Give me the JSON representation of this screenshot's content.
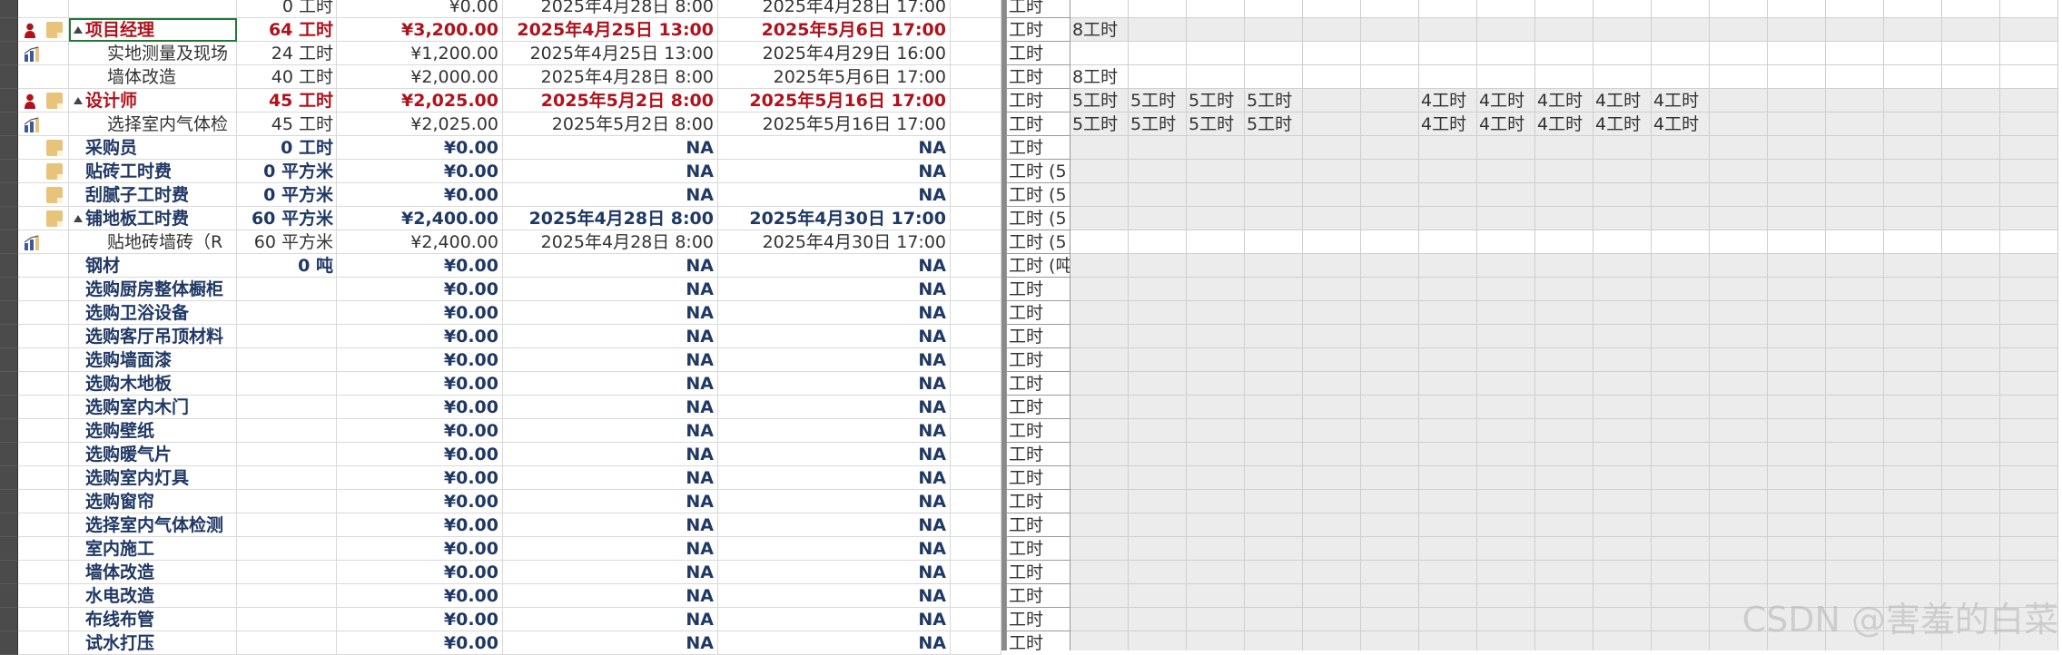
{
  "colors": {
    "summary_red": "#b0121b",
    "summary_blue": "#1f3864",
    "note_icon": "#e8c37a"
  },
  "tasks": [
    {
      "num": "",
      "icons": [],
      "name": "",
      "work": "0 工时",
      "cost": "¥0.00",
      "start": "2025年4月28日 8:00",
      "finish": "2025年4月28日 17:00",
      "style": "normal",
      "indent": 2,
      "tl_label": "工时",
      "tl": []
    },
    {
      "num": "",
      "icons": [
        "person-icon",
        "note-icon"
      ],
      "name": "项目经理",
      "work": "64 工时",
      "cost": "¥3,200.00",
      "start": "2025年4月25日 13:00",
      "finish": "2025年5月6日 17:00",
      "style": "summary-red",
      "indent": 0,
      "collapsible": true,
      "selected": true,
      "tl_label": "工时",
      "tl": [
        "8工时",
        "",
        "",
        "",
        "",
        "",
        "",
        "",
        "",
        "",
        "",
        "",
        "",
        "",
        "",
        "",
        ""
      ]
    },
    {
      "num": "",
      "icons": [
        "chart-icon"
      ],
      "name": "实地测量及现场",
      "work": "24 工时",
      "cost": "¥1,200.00",
      "start": "2025年4月25日 13:00",
      "finish": "2025年4月29日 16:00",
      "style": "normal",
      "indent": 2,
      "tl_label": "工时",
      "tl": []
    },
    {
      "num": "",
      "icons": [],
      "name": "墙体改造",
      "work": "40 工时",
      "cost": "¥2,000.00",
      "start": "2025年4月28日 8:00",
      "finish": "2025年5月6日 17:00",
      "style": "normal",
      "indent": 2,
      "tl_label": "工时",
      "tl": [
        "8工时"
      ]
    },
    {
      "num": "",
      "icons": [
        "person-icon",
        "note-icon"
      ],
      "name": "设计师",
      "work": "45 工时",
      "cost": "¥2,025.00",
      "start": "2025年5月2日 8:00",
      "finish": "2025年5月16日 17:00",
      "style": "summary-red",
      "indent": 0,
      "collapsible": true,
      "tl_label": "工时",
      "tl": [
        "5工时",
        "5工时",
        "5工时",
        "5工时",
        "",
        "",
        "4工时",
        "4工时",
        "4工时",
        "4工时",
        "4工时"
      ]
    },
    {
      "num": "",
      "icons": [
        "chart-icon"
      ],
      "name": "选择室内气体检",
      "work": "45 工时",
      "cost": "¥2,025.00",
      "start": "2025年5月2日 8:00",
      "finish": "2025年5月16日 17:00",
      "style": "normal",
      "indent": 2,
      "tl_label": "工时",
      "tl": [
        "5工时",
        "5工时",
        "5工时",
        "5工时",
        "",
        "",
        "4工时",
        "4工时",
        "4工时",
        "4工时",
        "4工时"
      ]
    },
    {
      "num": "",
      "icons": [
        "note-icon"
      ],
      "name": "采购员",
      "work": "0 工时",
      "cost": "¥0.00",
      "start": "NA",
      "finish": "NA",
      "style": "summary-blue",
      "indent": 1,
      "tl_label": "工时",
      "tl": []
    },
    {
      "num": "",
      "icons": [
        "note-icon"
      ],
      "name": "贴砖工时费",
      "work": "0 平方米",
      "cost": "¥0.00",
      "start": "NA",
      "finish": "NA",
      "style": "summary-blue",
      "indent": 1,
      "tl_label": "工时 (5",
      "tl": []
    },
    {
      "num": "",
      "icons": [
        "note-icon"
      ],
      "name": "刮腻子工时费",
      "work": "0 平方米",
      "cost": "¥0.00",
      "start": "NA",
      "finish": "NA",
      "style": "summary-blue",
      "indent": 1,
      "tl_label": "工时 (5",
      "tl": []
    },
    {
      "num": "",
      "icons": [
        "note-icon"
      ],
      "name": "铺地板工时费",
      "work": "60 平方米",
      "cost": "¥2,400.00",
      "start": "2025年4月28日 8:00",
      "finish": "2025年4月30日 17:00",
      "style": "summary-blue",
      "indent": 0,
      "collapsible": true,
      "tl_label": "工时 (5",
      "tl": []
    },
    {
      "num": "",
      "icons": [
        "chart-icon"
      ],
      "name": "贴地砖墙砖（R",
      "work": "60 平方米",
      "cost": "¥2,400.00",
      "start": "2025年4月28日 8:00",
      "finish": "2025年4月30日 17:00",
      "style": "normal",
      "indent": 2,
      "tl_label": "工时 (5",
      "tl": []
    },
    {
      "num": "",
      "icons": [],
      "name": "钢材",
      "work": "0 吨",
      "cost": "¥0.00",
      "start": "NA",
      "finish": "NA",
      "style": "summary-blue",
      "indent": 1,
      "tl_label": "工时 (吨",
      "tl": []
    },
    {
      "num": "",
      "icons": [],
      "name": "选购厨房整体橱柜",
      "work": "",
      "cost": "¥0.00",
      "start": "NA",
      "finish": "NA",
      "style": "summary-blue",
      "indent": 1,
      "tl_label": "工时",
      "tl": []
    },
    {
      "num": "",
      "icons": [],
      "name": "选购卫浴设备",
      "work": "",
      "cost": "¥0.00",
      "start": "NA",
      "finish": "NA",
      "style": "summary-blue",
      "indent": 1,
      "tl_label": "工时",
      "tl": []
    },
    {
      "num": "",
      "icons": [],
      "name": "选购客厅吊顶材料",
      "work": "",
      "cost": "¥0.00",
      "start": "NA",
      "finish": "NA",
      "style": "summary-blue",
      "indent": 1,
      "tl_label": "工时",
      "tl": []
    },
    {
      "num": "",
      "icons": [],
      "name": "选购墙面漆",
      "work": "",
      "cost": "¥0.00",
      "start": "NA",
      "finish": "NA",
      "style": "summary-blue",
      "indent": 1,
      "tl_label": "工时",
      "tl": []
    },
    {
      "num": "",
      "icons": [],
      "name": "选购木地板",
      "work": "",
      "cost": "¥0.00",
      "start": "NA",
      "finish": "NA",
      "style": "summary-blue",
      "indent": 1,
      "tl_label": "工时",
      "tl": []
    },
    {
      "num": "",
      "icons": [],
      "name": "选购室内木门",
      "work": "",
      "cost": "¥0.00",
      "start": "NA",
      "finish": "NA",
      "style": "summary-blue",
      "indent": 1,
      "tl_label": "工时",
      "tl": []
    },
    {
      "num": "",
      "icons": [],
      "name": "选购壁纸",
      "work": "",
      "cost": "¥0.00",
      "start": "NA",
      "finish": "NA",
      "style": "summary-blue",
      "indent": 1,
      "tl_label": "工时",
      "tl": []
    },
    {
      "num": "",
      "icons": [],
      "name": "选购暖气片",
      "work": "",
      "cost": "¥0.00",
      "start": "NA",
      "finish": "NA",
      "style": "summary-blue",
      "indent": 1,
      "tl_label": "工时",
      "tl": []
    },
    {
      "num": "",
      "icons": [],
      "name": "选购室内灯具",
      "work": "",
      "cost": "¥0.00",
      "start": "NA",
      "finish": "NA",
      "style": "summary-blue",
      "indent": 1,
      "tl_label": "工时",
      "tl": []
    },
    {
      "num": "",
      "icons": [],
      "name": "选购窗帘",
      "work": "",
      "cost": "¥0.00",
      "start": "NA",
      "finish": "NA",
      "style": "summary-blue",
      "indent": 1,
      "tl_label": "工时",
      "tl": []
    },
    {
      "num": "",
      "icons": [],
      "name": "选择室内气体检测",
      "work": "",
      "cost": "¥0.00",
      "start": "NA",
      "finish": "NA",
      "style": "summary-blue",
      "indent": 1,
      "tl_label": "工时",
      "tl": []
    },
    {
      "num": "",
      "icons": [],
      "name": "室内施工",
      "work": "",
      "cost": "¥0.00",
      "start": "NA",
      "finish": "NA",
      "style": "summary-blue",
      "indent": 1,
      "tl_label": "工时",
      "tl": []
    },
    {
      "num": "",
      "icons": [],
      "name": "墙体改造",
      "work": "",
      "cost": "¥0.00",
      "start": "NA",
      "finish": "NA",
      "style": "summary-blue",
      "indent": 1,
      "tl_label": "工时",
      "tl": []
    },
    {
      "num": "",
      "icons": [],
      "name": "水电改造",
      "work": "",
      "cost": "¥0.00",
      "start": "NA",
      "finish": "NA",
      "style": "summary-blue",
      "indent": 1,
      "tl_label": "工时",
      "tl": []
    },
    {
      "num": "",
      "icons": [],
      "name": "布线布管",
      "work": "",
      "cost": "¥0.00",
      "start": "NA",
      "finish": "NA",
      "style": "summary-blue",
      "indent": 1,
      "tl_label": "工时",
      "tl": []
    },
    {
      "num": "",
      "icons": [],
      "name": "试水打压",
      "work": "",
      "cost": "¥0.00",
      "start": "NA",
      "finish": "NA",
      "style": "summary-blue",
      "indent": 1,
      "tl_label": "工时",
      "tl": []
    }
  ],
  "watermark": "CSDN @害羞的白菜"
}
